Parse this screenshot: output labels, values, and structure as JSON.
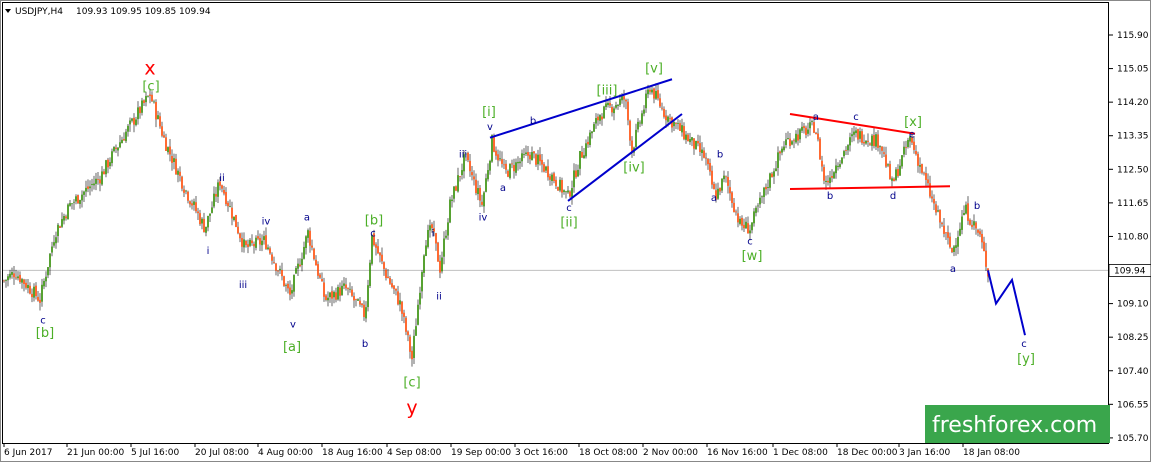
{
  "chart_data": {
    "type": "candlestick",
    "title": "USDJPY,H4",
    "ohlc_header": "109.93 109.95 109.85 109.94",
    "last_price": "109.94",
    "y_ticks": [
      "115.90",
      "115.05",
      "114.20",
      "113.35",
      "112.50",
      "111.65",
      "110.80",
      "109.94",
      "109.10",
      "108.25",
      "107.40",
      "106.55",
      "105.70"
    ],
    "x_ticks": [
      "6 Jun 2017",
      "21 Jun 00:00",
      "5 Jul 16:00",
      "20 Jul 08:00",
      "4 Aug 00:00",
      "18 Aug 16:00",
      "4 Sep 08:00",
      "19 Sep 00:00",
      "3 Oct 16:00",
      "18 Oct 08:00",
      "2 Nov 00:00",
      "16 Nov 16:00",
      "1 Dec 08:00",
      "18 Dec 00:00",
      "3 Jan 16:00",
      "18 Jan 08:00"
    ],
    "price_path": [
      [
        0,
        109.6
      ],
      [
        15,
        109.9
      ],
      [
        40,
        109.2
      ],
      [
        55,
        110.9
      ],
      [
        70,
        111.6
      ],
      [
        100,
        112.3
      ],
      [
        120,
        113.2
      ],
      [
        150,
        114.4
      ],
      [
        165,
        113.2
      ],
      [
        185,
        112.0
      ],
      [
        205,
        111.0
      ],
      [
        220,
        112.2
      ],
      [
        245,
        110.5
      ],
      [
        265,
        110.7
      ],
      [
        290,
        109.3
      ],
      [
        308,
        110.9
      ],
      [
        325,
        109.2
      ],
      [
        345,
        109.5
      ],
      [
        365,
        108.8
      ],
      [
        372,
        110.8
      ],
      [
        385,
        109.9
      ],
      [
        400,
        109.1
      ],
      [
        412,
        107.7
      ],
      [
        425,
        110.7
      ],
      [
        432,
        111.0
      ],
      [
        440,
        110.0
      ],
      [
        450,
        111.6
      ],
      [
        465,
        112.8
      ],
      [
        482,
        111.6
      ],
      [
        492,
        113.2
      ],
      [
        505,
        112.4
      ],
      [
        530,
        112.9
      ],
      [
        550,
        112.4
      ],
      [
        568,
        111.8
      ],
      [
        580,
        112.8
      ],
      [
        600,
        113.9
      ],
      [
        625,
        114.3
      ],
      [
        632,
        113.0
      ],
      [
        650,
        114.6
      ],
      [
        665,
        113.9
      ],
      [
        680,
        113.5
      ],
      [
        705,
        112.8
      ],
      [
        715,
        111.8
      ],
      [
        725,
        112.3
      ],
      [
        740,
        111.1
      ],
      [
        750,
        111.0
      ],
      [
        770,
        112.3
      ],
      [
        785,
        113.2
      ],
      [
        800,
        113.4
      ],
      [
        815,
        113.6
      ],
      [
        825,
        112.1
      ],
      [
        840,
        112.8
      ],
      [
        855,
        113.4
      ],
      [
        880,
        113.2
      ],
      [
        892,
        112.1
      ],
      [
        910,
        113.3
      ],
      [
        920,
        112.6
      ],
      [
        935,
        111.5
      ],
      [
        952,
        110.4
      ],
      [
        965,
        111.5
      ],
      [
        980,
        110.8
      ],
      [
        988,
        109.9
      ]
    ],
    "projection": [
      [
        988,
        109.94
      ],
      [
        996,
        109.1
      ],
      [
        1012,
        109.7
      ],
      [
        1025,
        108.3
      ]
    ],
    "trendlines": [
      {
        "color": "#0000cc",
        "from": [
          490,
          113.3
        ],
        "to": [
          672,
          114.78
        ]
      },
      {
        "color": "#0000cc",
        "from": [
          568,
          111.7
        ],
        "to": [
          682,
          113.9
        ]
      },
      {
        "color": "#ff0000",
        "from": [
          790,
          113.9
        ],
        "to": [
          915,
          113.4
        ]
      },
      {
        "color": "#ff0000",
        "from": [
          790,
          112.0
        ],
        "to": [
          950,
          112.07
        ]
      }
    ],
    "wave_labels": [
      {
        "text": "x",
        "color": "#ff0000",
        "x": 150,
        "y": 114.9,
        "size": 19
      },
      {
        "text": "[c]",
        "color": "#4caf27",
        "x": 151,
        "y": 114.5,
        "size": 13
      },
      {
        "text": "y",
        "color": "#ff0000",
        "x": 412,
        "y": 106.3,
        "size": 19
      },
      {
        "text": "[c]",
        "color": "#4caf27",
        "x": 412,
        "y": 107.0,
        "size": 13
      },
      {
        "text": "c",
        "color": "#00008b",
        "x": 43,
        "y": 108.6,
        "size": 10
      },
      {
        "text": "[b]",
        "color": "#4caf27",
        "x": 45,
        "y": 108.25,
        "size": 13
      },
      {
        "text": "ii",
        "color": "#00008b",
        "x": 222,
        "y": 112.2,
        "size": 10
      },
      {
        "text": "i",
        "color": "#00008b",
        "x": 208,
        "y": 110.35,
        "size": 10
      },
      {
        "text": "iii",
        "color": "#00008b",
        "x": 243,
        "y": 109.5,
        "size": 10
      },
      {
        "text": "iv",
        "color": "#00008b",
        "x": 266,
        "y": 111.1,
        "size": 10
      },
      {
        "text": "v",
        "color": "#00008b",
        "x": 293,
        "y": 108.5,
        "size": 10
      },
      {
        "text": "[a]",
        "color": "#4caf27",
        "x": 292,
        "y": 107.9,
        "size": 13
      },
      {
        "text": "a",
        "color": "#00008b",
        "x": 307,
        "y": 111.2,
        "size": 10
      },
      {
        "text": "[b]",
        "color": "#4caf27",
        "x": 374,
        "y": 111.1,
        "size": 13
      },
      {
        "text": "c",
        "color": "#00008b",
        "x": 373,
        "y": 110.8,
        "size": 10
      },
      {
        "text": "b",
        "color": "#00008b",
        "x": 365,
        "y": 108.0,
        "size": 10
      },
      {
        "text": "i",
        "color": "#00008b",
        "x": 433,
        "y": 110.8,
        "size": 10
      },
      {
        "text": "ii",
        "color": "#00008b",
        "x": 439,
        "y": 109.2,
        "size": 10
      },
      {
        "text": "iii",
        "color": "#00008b",
        "x": 463,
        "y": 112.8,
        "size": 10
      },
      {
        "text": "iv",
        "color": "#00008b",
        "x": 483,
        "y": 111.2,
        "size": 10
      },
      {
        "text": "v",
        "color": "#00008b",
        "x": 490,
        "y": 113.5,
        "size": 10
      },
      {
        "text": "[i]",
        "color": "#4caf27",
        "x": 489,
        "y": 113.85,
        "size": 13
      },
      {
        "text": "a",
        "color": "#00008b",
        "x": 503,
        "y": 111.95,
        "size": 10
      },
      {
        "text": "b",
        "color": "#00008b",
        "x": 533,
        "y": 113.65,
        "size": 10
      },
      {
        "text": "c",
        "color": "#00008b",
        "x": 569,
        "y": 111.45,
        "size": 10
      },
      {
        "text": "[ii]",
        "color": "#4caf27",
        "x": 569,
        "y": 111.05,
        "size": 13
      },
      {
        "text": "[iii]",
        "color": "#4caf27",
        "x": 607,
        "y": 114.4,
        "size": 13
      },
      {
        "text": "[iv]",
        "color": "#4caf27",
        "x": 634,
        "y": 112.45,
        "size": 13
      },
      {
        "text": "[v]",
        "color": "#4caf27",
        "x": 654,
        "y": 114.95,
        "size": 13
      },
      {
        "text": "b",
        "color": "#00008b",
        "x": 720,
        "y": 112.8,
        "size": 10
      },
      {
        "text": "a",
        "color": "#00008b",
        "x": 714,
        "y": 111.7,
        "size": 10
      },
      {
        "text": "c",
        "color": "#00008b",
        "x": 750,
        "y": 110.6,
        "size": 10
      },
      {
        "text": "[w]",
        "color": "#4caf27",
        "x": 752,
        "y": 110.2,
        "size": 13
      },
      {
        "text": "a",
        "color": "#00008b",
        "x": 816,
        "y": 113.75,
        "size": 10
      },
      {
        "text": "c",
        "color": "#00008b",
        "x": 856,
        "y": 113.75,
        "size": 10
      },
      {
        "text": "b",
        "color": "#00008b",
        "x": 830,
        "y": 111.75,
        "size": 10
      },
      {
        "text": "d",
        "color": "#00008b",
        "x": 893,
        "y": 111.75,
        "size": 10
      },
      {
        "text": "e",
        "color": "#00008b",
        "x": 912,
        "y": 113.3,
        "size": 10
      },
      {
        "text": "[x]",
        "color": "#4caf27",
        "x": 913,
        "y": 113.6,
        "size": 13
      },
      {
        "text": "b",
        "color": "#00008b",
        "x": 977,
        "y": 111.5,
        "size": 10
      },
      {
        "text": "a",
        "color": "#00008b",
        "x": 953,
        "y": 109.9,
        "size": 10
      },
      {
        "text": "c",
        "color": "#00008b",
        "x": 1024,
        "y": 108.0,
        "size": 10
      },
      {
        "text": "[y]",
        "color": "#4caf27",
        "x": 1026,
        "y": 107.6,
        "size": 13
      }
    ],
    "colors": {
      "bull": "#2e8b00",
      "bear": "#ff4500",
      "wick": "#000000",
      "wave_green": "#4caf27",
      "wave_blue": "#00008b",
      "wave_red": "#ff0000",
      "trend_blue": "#0000cc",
      "logo_bg": "#3aa64c"
    },
    "grid": false
  },
  "header": {
    "icon": "triangle-down-icon",
    "symbol": "USDJPY,H4",
    "ohlc": "109.93 109.95 109.85 109.94"
  },
  "price_tag": "109.94",
  "logo": {
    "text": "freshforex.com"
  }
}
